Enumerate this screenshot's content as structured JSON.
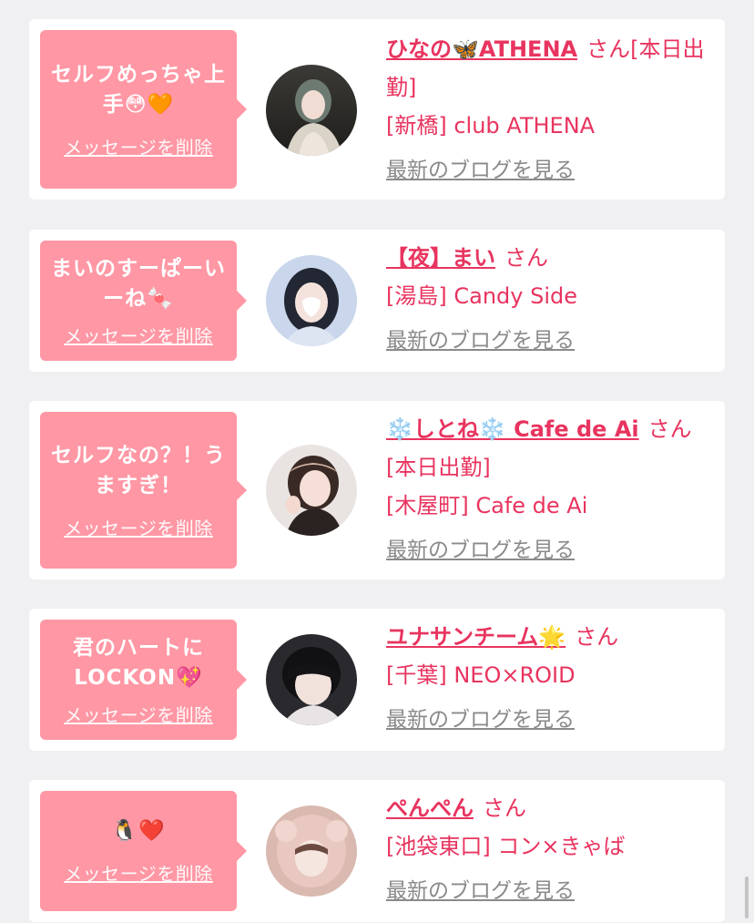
{
  "cards": [
    {
      "message": "セルフめっちゃ上手😳🧡",
      "delete_label": "メッセージを削除",
      "name": "ひなの🦋ATHENA",
      "san": "さん",
      "lines": [
        "[本日出勤]",
        "[新橋] club ATHENA"
      ],
      "blog_label": "最新のブログを見る"
    },
    {
      "message": "まいのすーぱーいーね🍬",
      "delete_label": "メッセージを削除",
      "name": "【夜】まい",
      "san": "さん",
      "lines": [
        "[湯島] Candy Side"
      ],
      "blog_label": "最新のブログを見る"
    },
    {
      "message": "セルフなの？！うますぎ！",
      "delete_label": "メッセージを削除",
      "name": "❄️しとね❄️ Cafe de Ai",
      "san": "さん",
      "lines": [
        "[本日出勤]",
        "[木屋町] Cafe de Ai"
      ],
      "blog_label": "最新のブログを見る"
    },
    {
      "message": "君のハートにLOCKON💖",
      "delete_label": "メッセージを削除",
      "name": "ユナサンチーム🌟",
      "san": "さん",
      "lines": [
        "[千葉] NEO×ROID"
      ],
      "blog_label": "最新のブログを見る"
    },
    {
      "message": "🐧❤️",
      "delete_label": "メッセージを削除",
      "name": "ぺんぺん",
      "san": "さん",
      "lines": [
        "[池袋東口] コン×きゃば"
      ],
      "blog_label": "最新のブログを見る"
    }
  ],
  "colors": {
    "accent": "#e8345f",
    "bubble": "#ff97a4",
    "link_gray": "#8a8a8a",
    "background": "#f0f0f2"
  }
}
